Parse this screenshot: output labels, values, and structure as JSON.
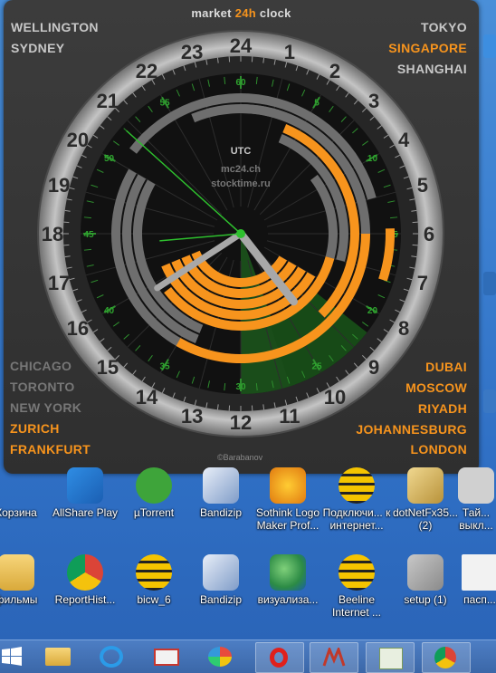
{
  "widget": {
    "title_prefix": "market ",
    "title_accent": "24h",
    "title_suffix": " clock",
    "left_top_cities": [
      "WELLINGTON",
      "SYDNEY"
    ],
    "right_top_cities": [
      "TOKYO",
      "SINGAPORE",
      "SHANGHAI"
    ],
    "left_bottom_cities": [
      "CHICAGO",
      "TORONTO",
      "NEW YORK",
      "ZURICH",
      "FRANKFURT"
    ],
    "right_bottom_cities": [
      "DUBAI",
      "MOSCOW",
      "RIYADH",
      "JOHANNESBURG",
      "LONDON"
    ],
    "center_label": "UTC",
    "center_site1": "mc24.ch",
    "center_site2": "stocktime.ru",
    "copyright": "©Barabanov",
    "hours": [
      "24",
      "1",
      "2",
      "3",
      "4",
      "5",
      "6",
      "7",
      "8",
      "9",
      "10",
      "11",
      "12",
      "13",
      "14",
      "15",
      "16",
      "17",
      "18",
      "19",
      "20",
      "21",
      "22",
      "23"
    ],
    "minute_labels": [
      "5",
      "10",
      "15",
      "20",
      "25",
      "30",
      "35",
      "40",
      "45",
      "50",
      "55",
      "60"
    ],
    "colors": {
      "open": "#f7941d",
      "closed": "#6e6e6e",
      "grey_text": "#c8c8c8",
      "dim_text": "#777777",
      "green": "#1a5c1a",
      "bezel": "#9a9a9a"
    }
  },
  "desktop": {
    "row1": [
      "Корзина",
      "AllShare Play",
      "µTorrent",
      "Bandizip",
      "Sothink Logo Maker Prof...",
      "Подключи... к интернет...",
      "dotNetFx35... (2)",
      "Тай... выкл..."
    ],
    "row2": [
      "фильмы",
      "ReportHist...",
      "bicw_6",
      "Bandizip",
      "визуализа...",
      "Beeline Internet ...",
      "setup (1)",
      "пасп..."
    ]
  }
}
